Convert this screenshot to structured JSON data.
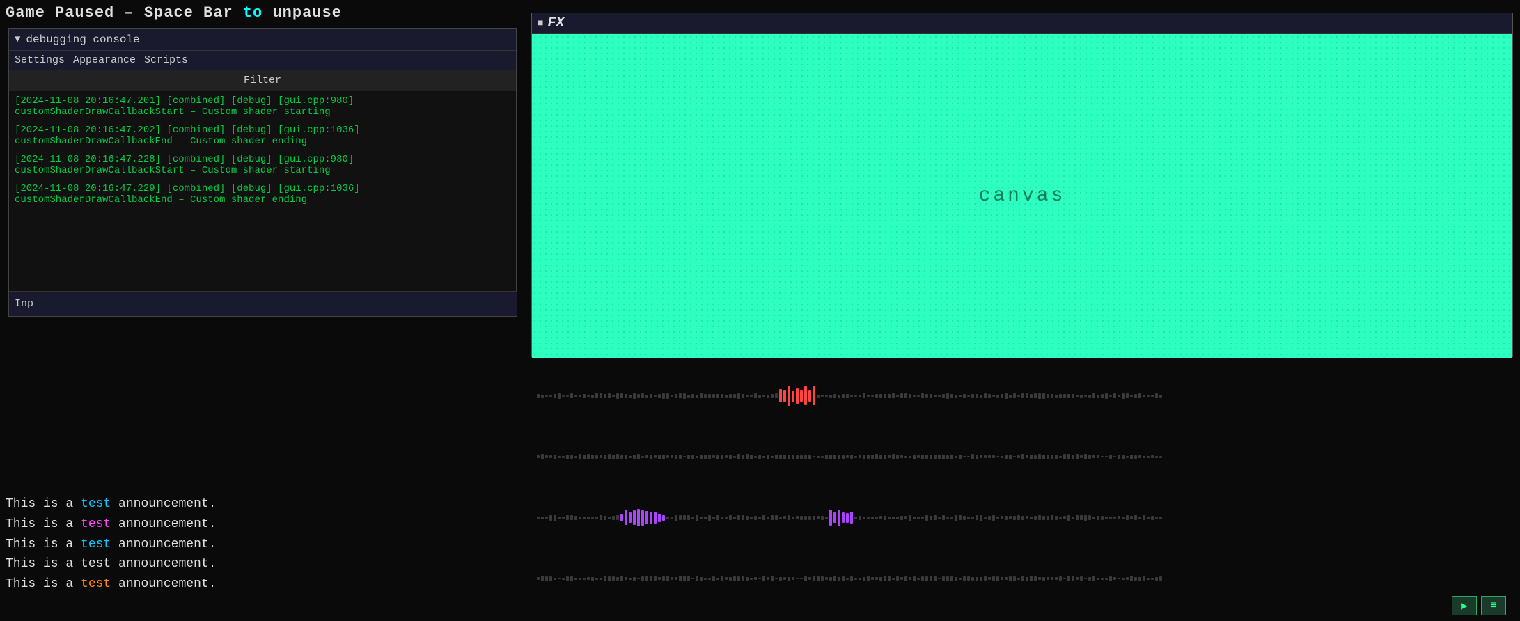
{
  "title_bar": {
    "text": "Game Paused – Space Bar to unpause",
    "prefix": "Game Paused – Space Bar ",
    "keyword": "to",
    "suffix": " unpause"
  },
  "debug_console": {
    "title": "debugging console",
    "triangle": "▼",
    "menu_items": [
      "Settings",
      "Appearance",
      "Scripts"
    ],
    "filter_placeholder": "Filter",
    "log_entries": [
      {
        "header": "[2024-11-08 20:16:47.201] [combined] [debug] [gui.cpp:980]",
        "message": "customShaderDrawCallbackStart – Custom shader starting"
      },
      {
        "header": "[2024-11-08 20:16:47.202] [combined] [debug] [gui.cpp:1036]",
        "message": "customShaderDrawCallbackEnd – Custom shader ending"
      },
      {
        "header": "[2024-11-08 20:16:47.228] [combined] [debug] [gui.cpp:980]",
        "message": "customShaderDrawCallbackStart – Custom shader starting"
      },
      {
        "header": "[2024-11-08 20:16:47.229] [combined] [debug] [gui.cpp:1036]",
        "message": "customShaderDrawCallbackEnd – Custom shader ending"
      }
    ],
    "input_label": "Inp"
  },
  "announcements": [
    {
      "text_before": "This is a ",
      "keyword": "test",
      "keyword_color": "cyan",
      "text_after": " announcement."
    },
    {
      "text_before": "This is a ",
      "keyword": "test",
      "keyword_color": "magenta",
      "text_after": " announcement."
    },
    {
      "text_before": "This is a ",
      "keyword": "test",
      "keyword_color": "cyan",
      "text_after": " announcement."
    },
    {
      "text_before": "This is a test announcement.",
      "keyword": "",
      "keyword_color": "",
      "text_after": ""
    },
    {
      "text_before": "This is a ",
      "keyword": "test",
      "keyword_color": "orange",
      "text_after": " announcement."
    }
  ],
  "fx_window": {
    "dot": "■",
    "title": "FX",
    "canvas_label": "canvas",
    "canvas_bg": "#2dffc0"
  },
  "bottom_controls": {
    "btn1_label": "▶",
    "btn2_label": "≡"
  }
}
